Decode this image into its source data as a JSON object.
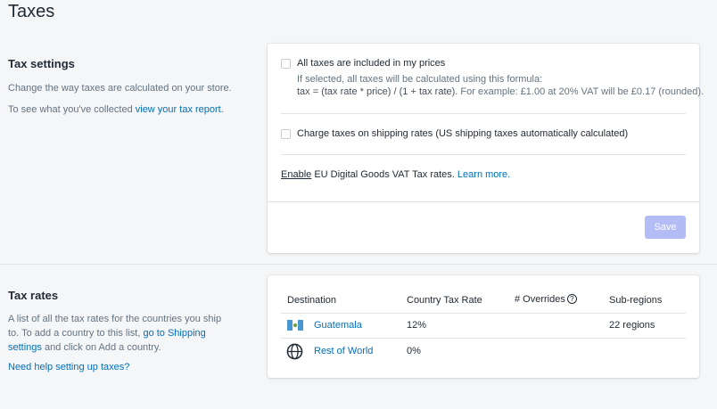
{
  "page": {
    "title": "Taxes"
  },
  "tax_settings": {
    "title": "Tax settings",
    "description": "Change the way taxes are calculated on your store.",
    "report_prefix": "To see what you've collected",
    "report_link": "view your tax report.",
    "option_included": {
      "label": "All taxes are included in my prices",
      "help_line1": "If selected, all taxes will be calculated using this formula:",
      "formula": "tax = (tax rate * price) / (1 + tax rate).",
      "example": "For example: £1.00 at 20% VAT will be £0.17 (rounded).",
      "checked": false
    },
    "option_shipping": {
      "label": "Charge taxes on shipping rates (US shipping taxes automatically calculated)",
      "checked": false
    },
    "eu": {
      "enable_link": "Enable",
      "text": "EU Digital Goods VAT Tax rates.",
      "learn_more": "Learn more."
    },
    "save_label": "Save"
  },
  "tax_rates": {
    "title": "Tax rates",
    "description_prefix": "A list of all the tax rates for the countries you ship to. To add a country to this list,",
    "shipping_link": "go to Shipping settings",
    "description_suffix": "and click on Add a country.",
    "help_link": "Need help setting up taxes?",
    "columns": [
      "Destination",
      "Country Tax Rate",
      "# Overrides",
      "Sub-regions"
    ],
    "rows": [
      {
        "destination": "Guatemala",
        "rate": "12%",
        "overrides": "",
        "subregions": "22 regions",
        "icon": "guatemala-flag-icon"
      },
      {
        "destination": "Rest of World",
        "rate": "0%",
        "overrides": "",
        "subregions": "",
        "icon": "globe-icon"
      }
    ]
  },
  "colors": {
    "accent": "#006fbb",
    "save_disabled": "#b3bcf5",
    "background": "#f4f6f8"
  }
}
